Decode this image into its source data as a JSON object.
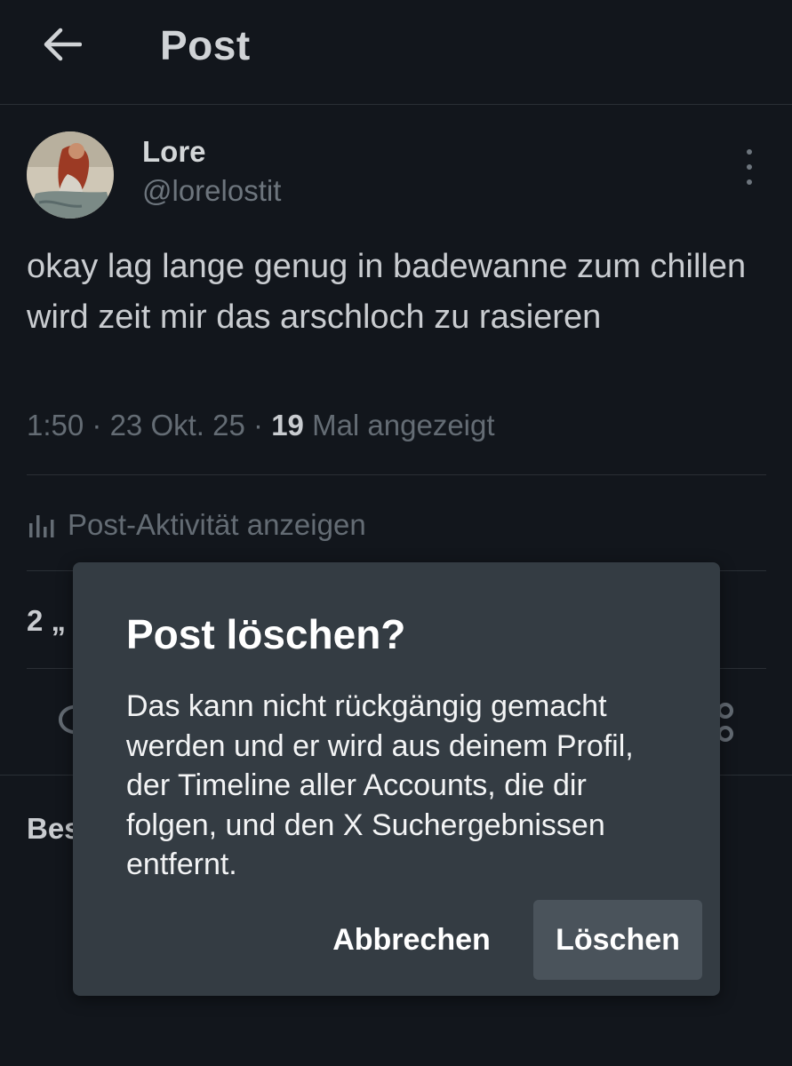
{
  "header": {
    "title": "Post"
  },
  "author": {
    "name": "Lore",
    "handle": "@lorelostit"
  },
  "post": {
    "text": "okay lag lange genug in badewanne zum chillen wird zeit mir das arschloch zu rasieren",
    "time": "1:50",
    "date": "23 Okt. 25",
    "views_count": "19",
    "views_label": "Mal angezeigt"
  },
  "activity": {
    "label": "Post-Aktivität anzeigen"
  },
  "stats": {
    "text": "2 „"
  },
  "section": {
    "label": "Bes"
  },
  "dialog": {
    "title": "Post löschen?",
    "body": "Das kann nicht rückgängig gemacht werden und er wird aus deinem Profil, der Timeline aller Accounts, die dir folgen, und den X Suchergebnissen entfernt.",
    "cancel_label": "Abbrechen",
    "delete_label": "Löschen"
  },
  "icons": {
    "back": "arrow-left-icon",
    "more": "more-vertical-icon",
    "activity": "bar-chart-icon"
  },
  "colors": {
    "background": "#12161c",
    "dialog_bg": "#343c43",
    "delete_button_bg": "#4a535b",
    "muted_text": "#646c74"
  }
}
